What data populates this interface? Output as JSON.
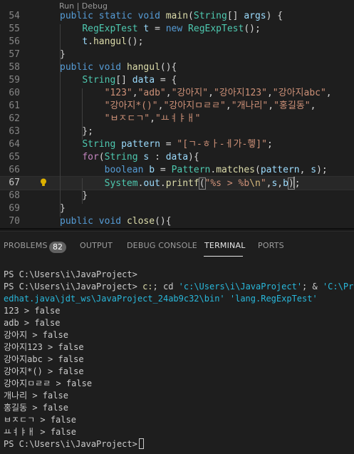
{
  "editor": {
    "codelens": "Run | Debug",
    "lines": [
      {
        "num": "54",
        "html": "<span style=\"color:#569cd6\">public</span> <span style=\"color:#569cd6\">static</span> <span style=\"color:#569cd6\">void</span> <span style=\"color:#dcdcaa\">main</span>(<span style=\"color:#4ec9b0\">String</span>[] <span style=\"color:#9cdcfe\">args</span>) {"
      },
      {
        "num": "55",
        "html": "    <span style=\"color:#4ec9b0\">RegExpTest</span> <span style=\"color:#9cdcfe\">t</span> = <span style=\"color:#569cd6\">new</span> <span style=\"color:#4ec9b0\">RegExpTest</span>();"
      },
      {
        "num": "56",
        "html": "    <span style=\"color:#9cdcfe\">t</span>.<span style=\"color:#dcdcaa\">hangul</span>();"
      },
      {
        "num": "57",
        "html": "}"
      },
      {
        "num": "58",
        "html": "<span style=\"color:#569cd6\">public</span> <span style=\"color:#569cd6\">void</span> <span style=\"color:#dcdcaa\">hangul</span>(){"
      },
      {
        "num": "59",
        "html": "    <span style=\"color:#4ec9b0\">String</span>[] <span style=\"color:#9cdcfe\">data</span> = {"
      },
      {
        "num": "60",
        "html": "        <span style=\"color:#ce9178\">\"123\"</span>,<span style=\"color:#ce9178\">\"adb\"</span>,<span style=\"color:#ce9178\">\"강아지\"</span>,<span style=\"color:#ce9178\">\"강아지123\"</span>,<span style=\"color:#ce9178\">\"강아지abc\"</span>,"
      },
      {
        "num": "61",
        "html": "        <span style=\"color:#ce9178\">\"강아지*()\"</span>,<span style=\"color:#ce9178\">\"강아지ㅁㄹㄹ\"</span>,<span style=\"color:#ce9178\">\"개나리\"</span>,<span style=\"color:#ce9178\">\"홍길동\"</span>,"
      },
      {
        "num": "62",
        "html": "        <span style=\"color:#ce9178\">\"ㅂㅈㄷㄱ\"</span>,<span style=\"color:#ce9178\">\"ㅛㅕㅑㅐ\"</span>"
      },
      {
        "num": "63",
        "html": "    };"
      },
      {
        "num": "64",
        "html": "    <span style=\"color:#4ec9b0\">String</span> <span style=\"color:#9cdcfe\">pattern</span> = <span style=\"color:#ce9178\">\"[ㄱ-ㅎㅏ-ㅔ가-헿]\"</span>;"
      },
      {
        "num": "65",
        "html": "    <span style=\"color:#c586c0\">for</span>(<span style=\"color:#4ec9b0\">String</span> <span style=\"color:#9cdcfe\">s</span> : <span style=\"color:#9cdcfe\">data</span>){"
      },
      {
        "num": "66",
        "html": "        <span style=\"color:#569cd6\">boolean</span> <span style=\"color:#9cdcfe\">b</span> = <span style=\"color:#4ec9b0\">Pattern</span>.<span style=\"color:#dcdcaa\">matches</span>(<span style=\"color:#9cdcfe\">pattern</span>, <span style=\"color:#9cdcfe\">s</span>);"
      },
      {
        "num": "67",
        "html": "        <span style=\"color:#4ec9b0\">System</span>.<span style=\"color:#9cdcfe\">out</span>.<span style=\"color:#dcdcaa\">printf</span><span class=\"br-match\">(</span><span style=\"color:#ce9178\">\"%s &gt; %b</span><span style=\"color:#d7ba7d\">\\n</span><span style=\"color:#ce9178\">\"</span>,<span style=\"color:#9cdcfe\">s</span>,<span style=\"color:#9cdcfe\">b</span><span class=\"br-match\">)</span><span class=\"cursor\"></span>;"
      },
      {
        "num": "68",
        "html": "    }"
      },
      {
        "num": "69",
        "html": "}"
      },
      {
        "num": "70",
        "html": "<span style=\"color:#569cd6\">public</span> <span style=\"color:#569cd6\">void</span> <span style=\"color:#dcdcaa\">close</span>(){"
      }
    ]
  },
  "panel": {
    "tabs": {
      "problems": "PROBLEMS",
      "problems_count": "82",
      "output": "OUTPUT",
      "debug_console": "DEBUG CONSOLE",
      "terminal": "TERMINAL",
      "ports": "PORTS"
    },
    "terminal": {
      "prompt1": "PS C:\\Users\\i\\JavaProject>",
      "prompt2": "PS C:\\Users\\i\\JavaProject>",
      "cmd_c": "c:",
      "cmd_rest_a": "; cd ",
      "cmd_path": "'c:\\Users\\i\\JavaProject'",
      "cmd_rest_b": "; & ",
      "cmd_tail": "'C:\\Prog",
      "line2": "edhat.java\\jdt_ws\\JavaProject_24ab9c32\\bin' 'lang.RegExpTest'",
      "outputs": [
        "123 > false",
        "adb > false",
        "강아지 > false",
        "강아지123 > false",
        "강아지abc > false",
        "강아지*() > false",
        "강아지ㅁㄹㄹ > false",
        "개나리 > false",
        "홍길동 > false",
        "ㅂㅈㄷㄱ > false",
        "ㅛㅕㅑㅐ > false"
      ],
      "final_prompt": "PS C:\\Users\\i\\JavaProject>"
    }
  },
  "colors": {
    "keyword": "#569cd6",
    "type": "#4ec9b0",
    "function": "#dcdcaa",
    "variable": "#9cdcfe",
    "string": "#ce9178",
    "control": "#c586c0"
  }
}
